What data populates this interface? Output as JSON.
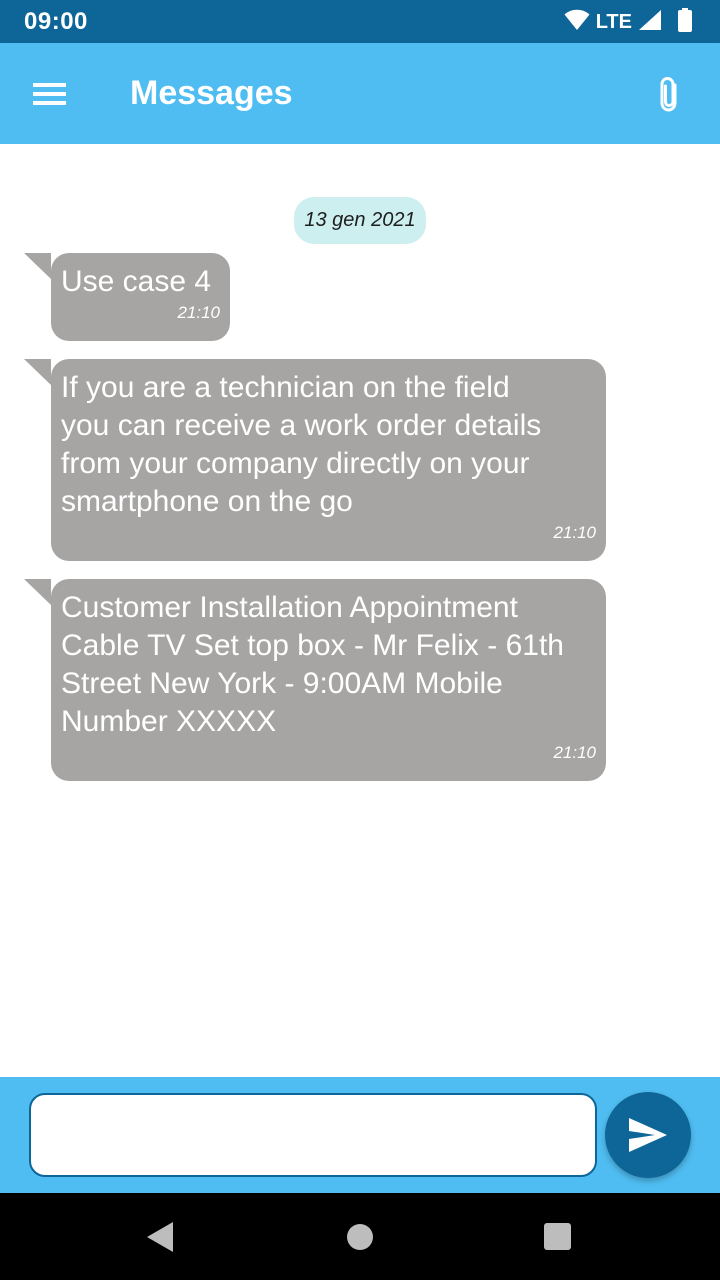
{
  "status_bar": {
    "time": "09:00",
    "network": "LTE",
    "icons": [
      "wifi-icon",
      "signal-icon",
      "battery-icon"
    ]
  },
  "app_bar": {
    "title": "Messages",
    "menu_icon": "hamburger-menu-icon",
    "attach_icon": "paperclip-icon"
  },
  "conversation": {
    "date_label": "13 gen 2021",
    "messages": [
      {
        "text": "Use case 4",
        "time": "21:10"
      },
      {
        "text": "If you are a technician on the field\nyou can receive a work order details\nfrom your company directly on your\nsmartphone on the go",
        "time": "21:10"
      },
      {
        "text": "Customer Installation Appointment\nCable TV Set top box - Mr Felix - 61th\nStreet New York - 9:00AM Mobile\nNumber XXXXX",
        "time": "21:10"
      }
    ]
  },
  "composer": {
    "input_value": "",
    "input_placeholder": "",
    "send_icon": "send-icon"
  },
  "colors": {
    "status_bar": "#0e6698",
    "app_bar": "#4fbdf1",
    "bubble": "#a6a5a4",
    "date_chip": "#cdeff0",
    "send_button": "#0e6698"
  },
  "navigation": {
    "icons": [
      "back-icon",
      "home-icon",
      "recents-icon"
    ]
  }
}
